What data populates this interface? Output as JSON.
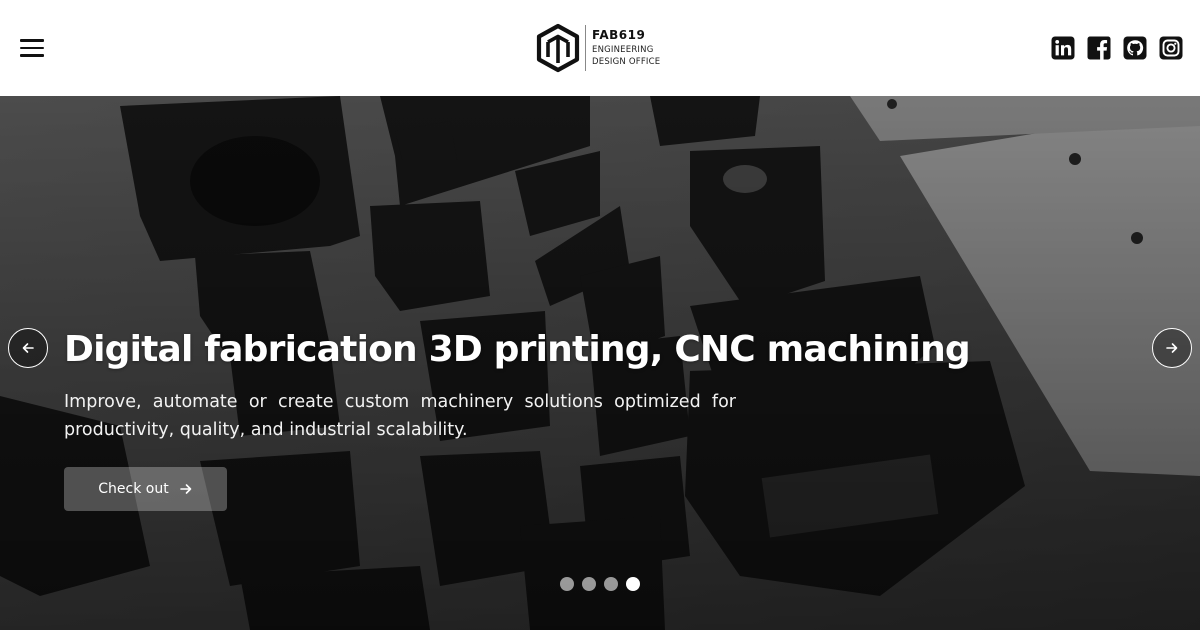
{
  "header": {
    "menu_icon": "hamburger-menu-icon",
    "logo": {
      "name": "FAB619",
      "line1": "ENGINEERING",
      "line2": "DESIGN OFFICE"
    },
    "social": [
      {
        "icon": "linkedin-icon",
        "label": "LinkedIn"
      },
      {
        "icon": "facebook-icon",
        "label": "Facebook"
      },
      {
        "icon": "github-icon",
        "label": "GitHub"
      },
      {
        "icon": "instagram-icon",
        "label": "Instagram"
      }
    ]
  },
  "hero": {
    "title": "Digital fabrication 3D printing, CNC machining",
    "description": "Improve, automate or create custom machinery solutions optimized for productivity, quality, and industrial scalability.",
    "cta_label": "Check out",
    "prev_icon": "arrow-left-icon",
    "next_icon": "arrow-right-icon",
    "slides_total": 4,
    "active_slide": 4
  },
  "colors": {
    "header_bg": "#ffffff",
    "text_dark": "#111111",
    "hero_text": "#ffffff"
  }
}
